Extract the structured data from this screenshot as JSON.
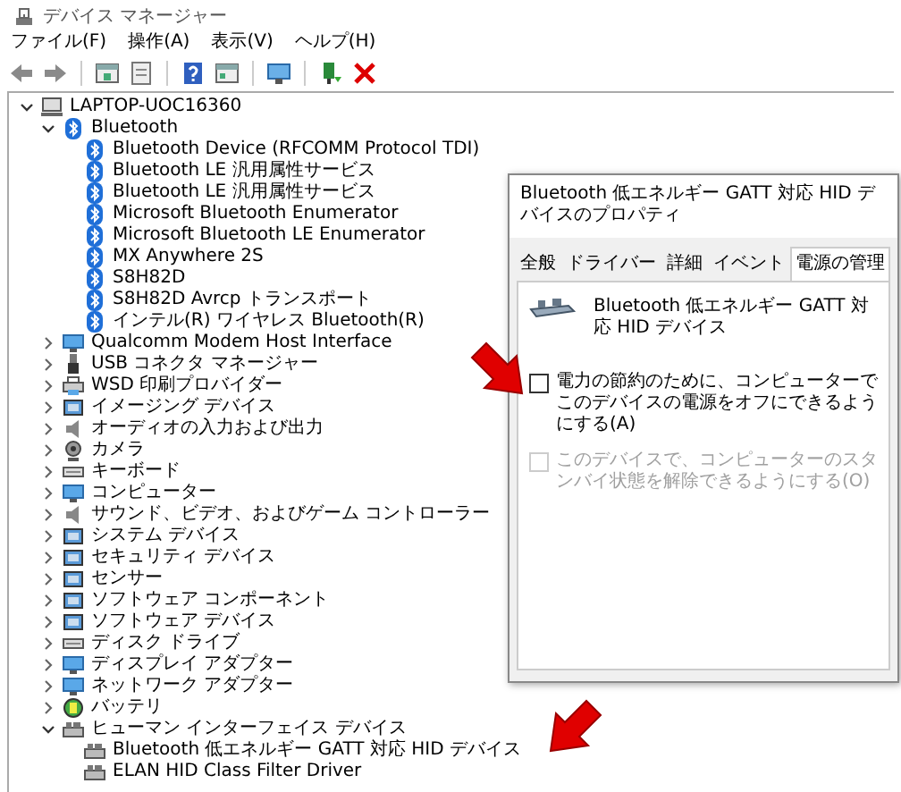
{
  "window": {
    "title": "デバイス マネージャー"
  },
  "menu": [
    "ファイル(F)",
    "操作(A)",
    "表示(V)",
    "ヘルプ(H)"
  ],
  "tree": {
    "label": "LAPTOP-UOC16360",
    "kind": "computer",
    "expanded": true,
    "children": [
      {
        "label": "Bluetooth",
        "kind": "bluetooth",
        "expanded": true,
        "children": [
          {
            "label": "Bluetooth Device (RFCOMM Protocol TDI)",
            "kind": "bluetooth"
          },
          {
            "label": "Bluetooth LE 汎用属性サービス",
            "kind": "bluetooth"
          },
          {
            "label": "Bluetooth LE 汎用属性サービス",
            "kind": "bluetooth"
          },
          {
            "label": "Microsoft Bluetooth Enumerator",
            "kind": "bluetooth"
          },
          {
            "label": "Microsoft Bluetooth LE Enumerator",
            "kind": "bluetooth"
          },
          {
            "label": "MX Anywhere 2S",
            "kind": "bluetooth"
          },
          {
            "label": "S8H82D",
            "kind": "bluetooth"
          },
          {
            "label": "S8H82D Avrcp トランスポート",
            "kind": "bluetooth"
          },
          {
            "label": "インテル(R) ワイヤレス Bluetooth(R)",
            "kind": "bluetooth"
          }
        ]
      },
      {
        "label": "Qualcomm Modem Host Interface",
        "kind": "monitor",
        "expanded": false
      },
      {
        "label": "USB コネクタ マネージャー",
        "kind": "usb",
        "expanded": false
      },
      {
        "label": "WSD 印刷プロバイダー",
        "kind": "printer",
        "expanded": false
      },
      {
        "label": "イメージング デバイス",
        "kind": "device",
        "expanded": false
      },
      {
        "label": "オーディオの入力および出力",
        "kind": "speaker",
        "expanded": false
      },
      {
        "label": "カメラ",
        "kind": "camera",
        "expanded": false
      },
      {
        "label": "キーボード",
        "kind": "keyboard",
        "expanded": false
      },
      {
        "label": "コンピューター",
        "kind": "monitor",
        "expanded": false
      },
      {
        "label": "サウンド、ビデオ、およびゲーム コントローラー",
        "kind": "speaker",
        "expanded": false
      },
      {
        "label": "システム デバイス",
        "kind": "device",
        "expanded": false
      },
      {
        "label": "セキュリティ デバイス",
        "kind": "device",
        "expanded": false
      },
      {
        "label": "センサー",
        "kind": "device",
        "expanded": false
      },
      {
        "label": "ソフトウェア コンポーネント",
        "kind": "device",
        "expanded": false
      },
      {
        "label": "ソフトウェア デバイス",
        "kind": "device",
        "expanded": false
      },
      {
        "label": "ディスク ドライブ",
        "kind": "keyboard",
        "expanded": false
      },
      {
        "label": "ディスプレイ アダプター",
        "kind": "monitor",
        "expanded": false
      },
      {
        "label": "ネットワーク アダプター",
        "kind": "monitor",
        "expanded": false
      },
      {
        "label": "バッテリ",
        "kind": "battery",
        "expanded": false
      },
      {
        "label": "ヒューマン インターフェイス デバイス",
        "kind": "hid",
        "expanded": true,
        "children": [
          {
            "label": "Bluetooth 低エネルギー GATT 対応 HID デバイス",
            "kind": "hid"
          },
          {
            "label": "ELAN HID Class Filter Driver",
            "kind": "hid"
          }
        ]
      }
    ]
  },
  "dialog": {
    "title": "Bluetooth 低エネルギー GATT 対応 HID デバイスのプロパティ",
    "tabs": [
      {
        "label": "全般",
        "selected": false
      },
      {
        "label": "ドライバー",
        "selected": false
      },
      {
        "label": "詳細",
        "selected": false
      },
      {
        "label": "イベント",
        "selected": false
      },
      {
        "label": "電源の管理",
        "selected": true
      }
    ],
    "device_name": "Bluetooth 低エネルギー GATT 対応 HID デバイス",
    "options": [
      {
        "label": "電力の節約のために、コンピューターでこのデバイスの電源をオフにできるようにする(A)",
        "checked": false,
        "disabled": false
      },
      {
        "label": "このデバイスで、コンピューターのスタンバイ状態を解除できるようにする(O)",
        "checked": false,
        "disabled": true
      }
    ]
  }
}
